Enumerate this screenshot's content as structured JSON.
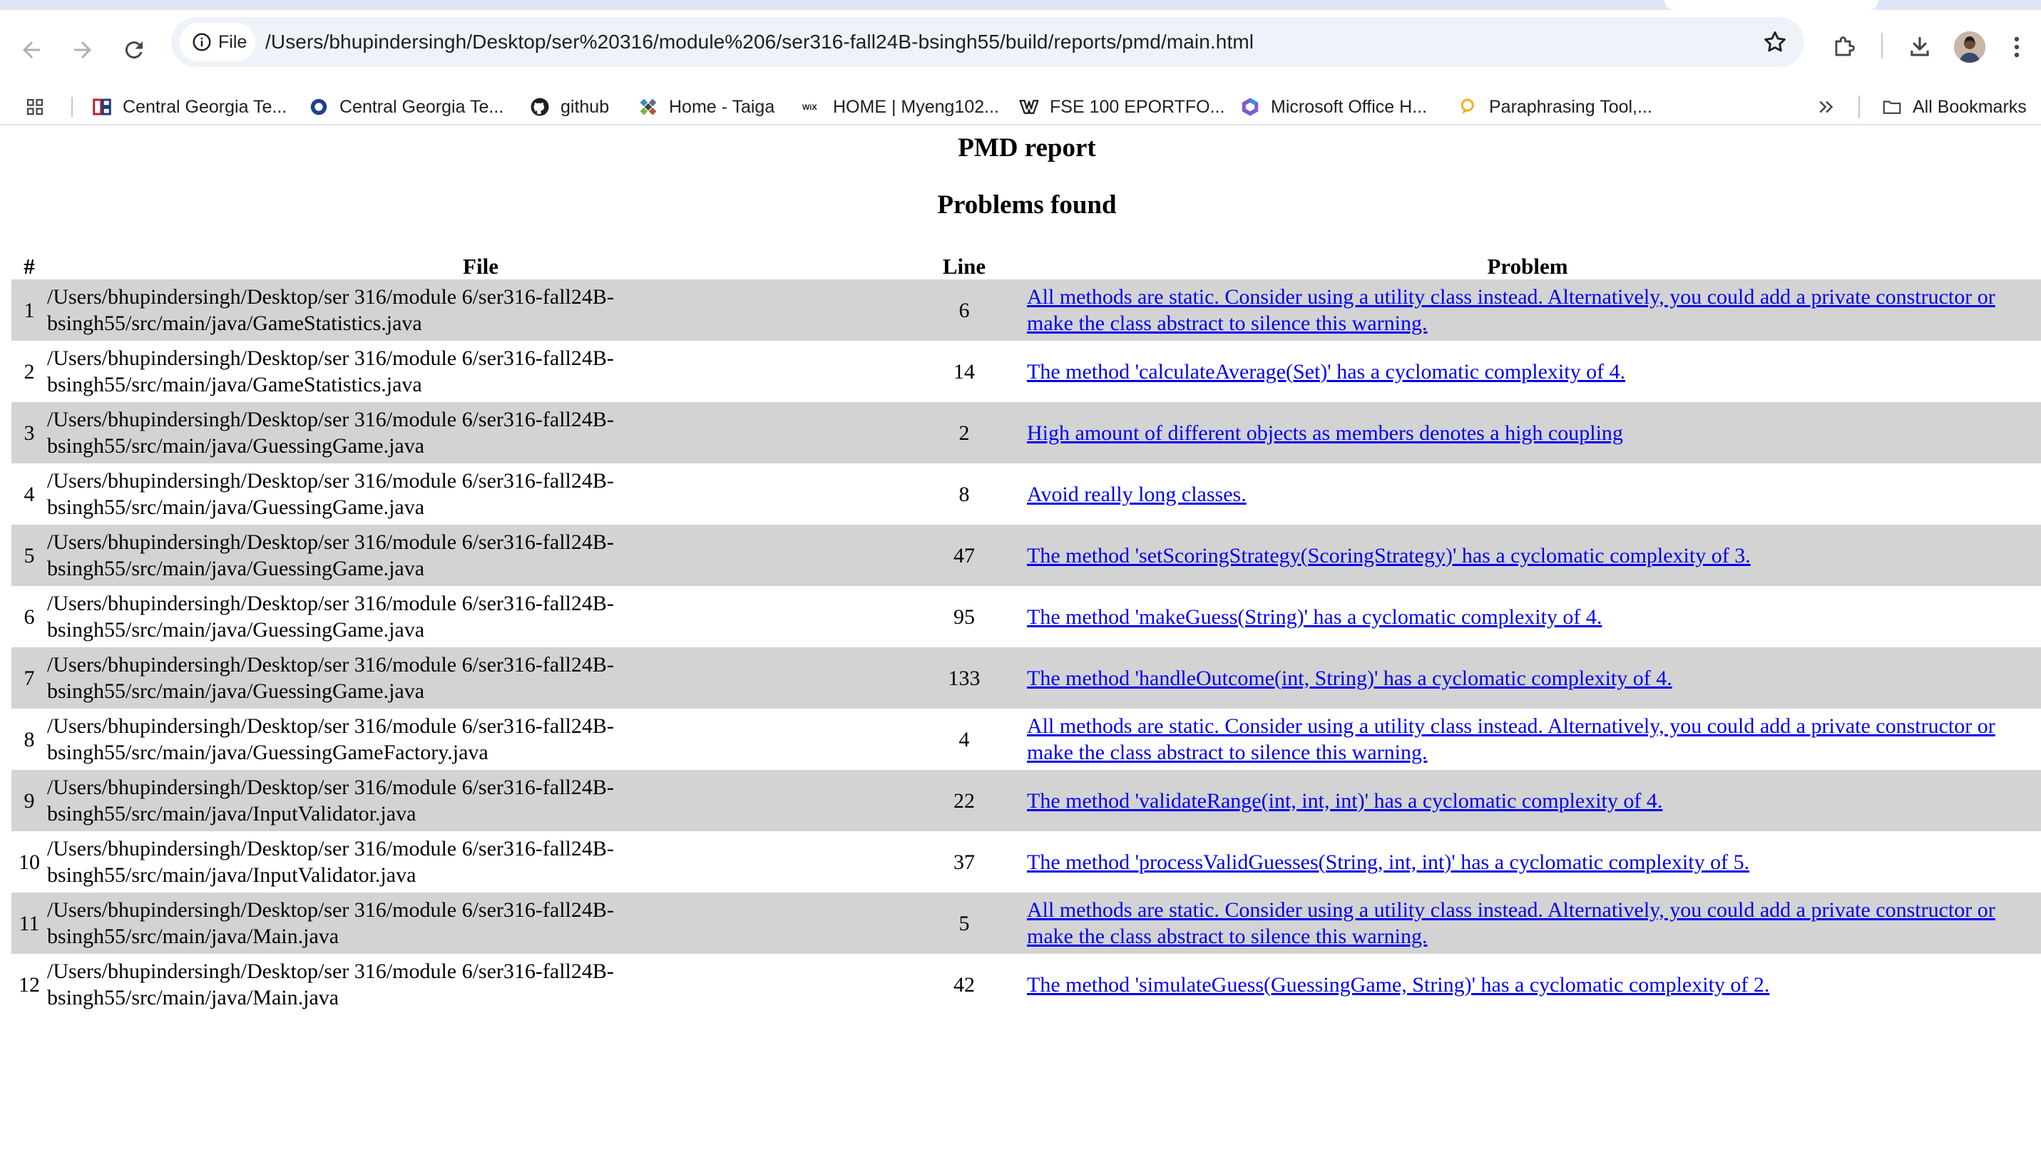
{
  "browser": {
    "url": "/Users/bhupindersingh/Desktop/ser%20316/module%206/ser316-fall24B-bsingh55/build/reports/pmd/main.html",
    "site_chip_label": "File",
    "bookmarks": [
      {
        "label": "Central Georgia Te...",
        "icon": "cgtc-icon"
      },
      {
        "label": "Central Georgia Te...",
        "icon": "ring-icon"
      },
      {
        "label": "github",
        "icon": "github-icon"
      },
      {
        "label": "Home - Taiga",
        "icon": "taiga-icon"
      },
      {
        "label": "HOME | Myeng102...",
        "icon": "wix-icon"
      },
      {
        "label": "FSE 100 EPORTFO...",
        "icon": "w-logo-icon"
      },
      {
        "label": "Microsoft Office H...",
        "icon": "office-icon"
      },
      {
        "label": "Paraphrasing Tool,...",
        "icon": "bubble-icon"
      }
    ],
    "all_bookmarks_label": "All Bookmarks"
  },
  "report": {
    "title": "PMD report",
    "subtitle": "Problems found",
    "headers": {
      "num": "#",
      "file": "File",
      "line": "Line",
      "problem": "Problem"
    },
    "rows": [
      {
        "num": "1",
        "file": "/Users/bhupindersingh/Desktop/ser 316/module 6/ser316-fall24B-bsingh55/src/main/java/GameStatistics.java",
        "line": "6",
        "problem": "All methods are static. Consider using a utility class instead. Alternatively, you could add a private constructor or make the class abstract to silence this warning."
      },
      {
        "num": "2",
        "file": "/Users/bhupindersingh/Desktop/ser 316/module 6/ser316-fall24B-bsingh55/src/main/java/GameStatistics.java",
        "line": "14",
        "problem": "The method 'calculateAverage(Set)' has a cyclomatic complexity of 4."
      },
      {
        "num": "3",
        "file": "/Users/bhupindersingh/Desktop/ser 316/module 6/ser316-fall24B-bsingh55/src/main/java/GuessingGame.java",
        "line": "2",
        "problem": "High amount of different objects as members denotes a high coupling"
      },
      {
        "num": "4",
        "file": "/Users/bhupindersingh/Desktop/ser 316/module 6/ser316-fall24B-bsingh55/src/main/java/GuessingGame.java",
        "line": "8",
        "problem": "Avoid really long classes."
      },
      {
        "num": "5",
        "file": "/Users/bhupindersingh/Desktop/ser 316/module 6/ser316-fall24B-bsingh55/src/main/java/GuessingGame.java",
        "line": "47",
        "problem": "The method 'setScoringStrategy(ScoringStrategy)' has a cyclomatic complexity of 3."
      },
      {
        "num": "6",
        "file": "/Users/bhupindersingh/Desktop/ser 316/module 6/ser316-fall24B-bsingh55/src/main/java/GuessingGame.java",
        "line": "95",
        "problem": "The method 'makeGuess(String)' has a cyclomatic complexity of 4."
      },
      {
        "num": "7",
        "file": "/Users/bhupindersingh/Desktop/ser 316/module 6/ser316-fall24B-bsingh55/src/main/java/GuessingGame.java",
        "line": "133",
        "problem": "The method 'handleOutcome(int, String)' has a cyclomatic complexity of 4."
      },
      {
        "num": "8",
        "file": "/Users/bhupindersingh/Desktop/ser 316/module 6/ser316-fall24B-bsingh55/src/main/java/GuessingGameFactory.java",
        "line": "4",
        "problem": "All methods are static. Consider using a utility class instead. Alternatively, you could add a private constructor or make the class abstract to silence this warning."
      },
      {
        "num": "9",
        "file": "/Users/bhupindersingh/Desktop/ser 316/module 6/ser316-fall24B-bsingh55/src/main/java/InputValidator.java",
        "line": "22",
        "problem": "The method 'validateRange(int, int, int)' has a cyclomatic complexity of 4."
      },
      {
        "num": "10",
        "file": "/Users/bhupindersingh/Desktop/ser 316/module 6/ser316-fall24B-bsingh55/src/main/java/InputValidator.java",
        "line": "37",
        "problem": "The method 'processValidGuesses(String, int, int)' has a cyclomatic complexity of 5."
      },
      {
        "num": "11",
        "file": "/Users/bhupindersingh/Desktop/ser 316/module 6/ser316-fall24B-bsingh55/src/main/java/Main.java",
        "line": "5",
        "problem": "All methods are static. Consider using a utility class instead. Alternatively, you could add a private constructor or make the class abstract to silence this warning."
      },
      {
        "num": "12",
        "file": "/Users/bhupindersingh/Desktop/ser 316/module 6/ser316-fall24B-bsingh55/src/main/java/Main.java",
        "line": "42",
        "problem": "The method 'simulateGuess(GuessingGame, String)' has a cyclomatic complexity of 2."
      }
    ]
  },
  "colors": {
    "row_alt": "#d3d3d3",
    "link": "#0000ee",
    "omnibox": "#eef2f9"
  }
}
